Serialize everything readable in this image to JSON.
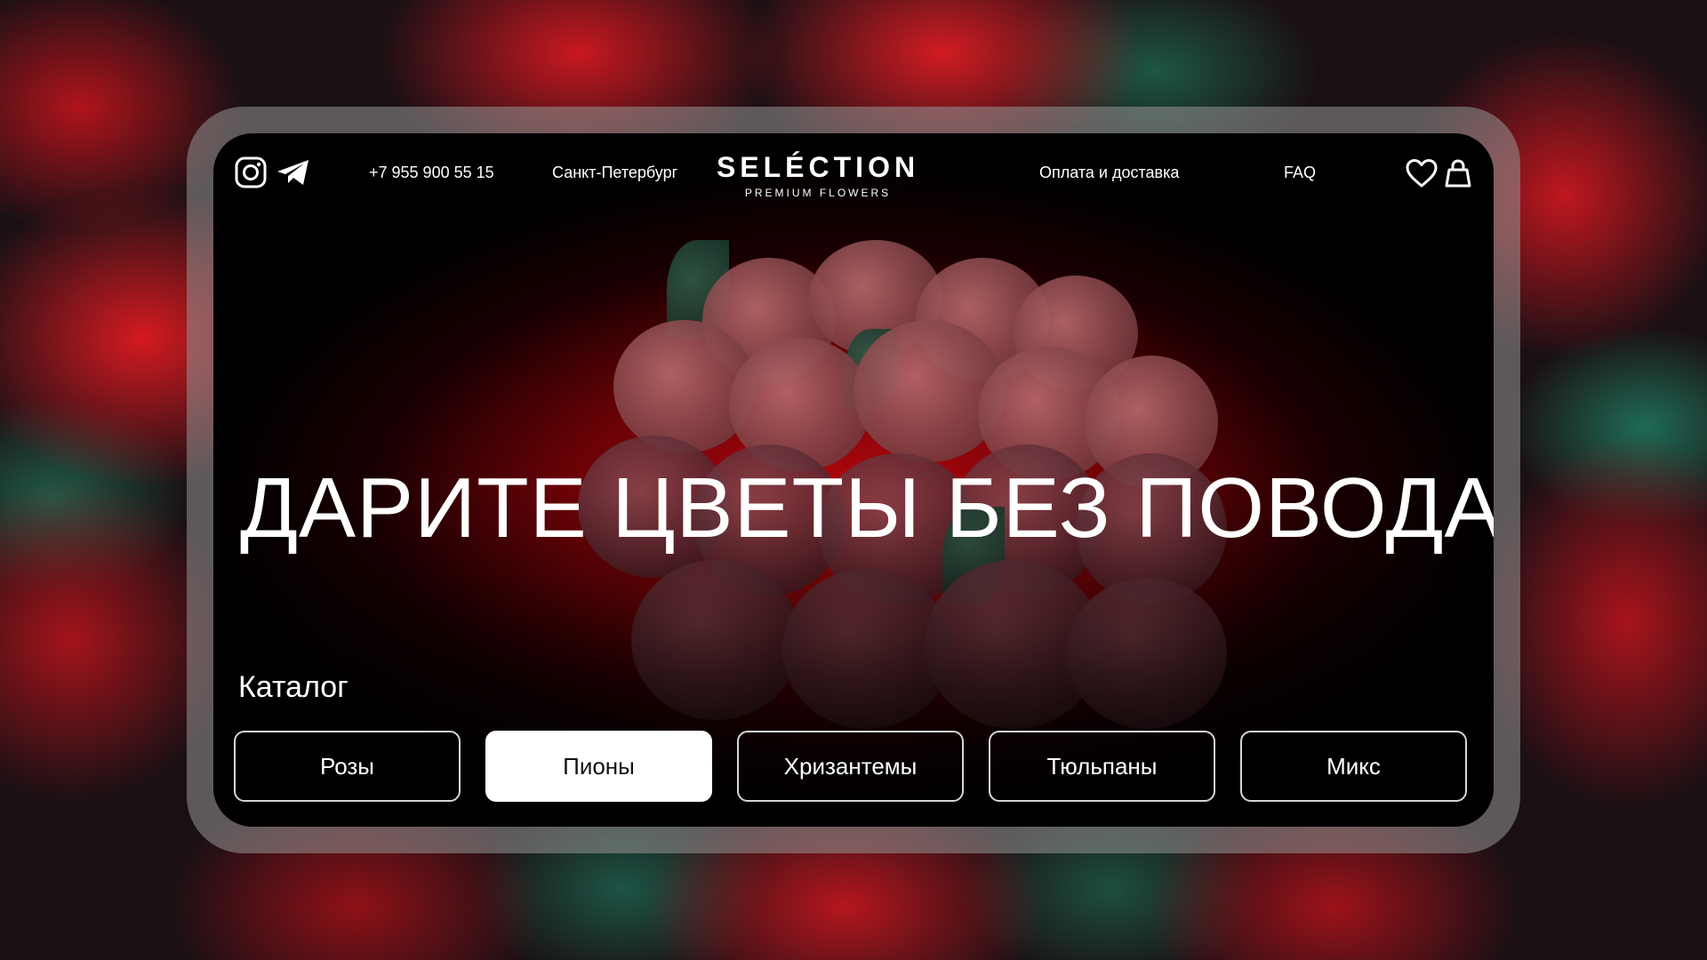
{
  "header": {
    "social": [
      {
        "icon": "instagram-icon"
      },
      {
        "icon": "telegram-icon"
      }
    ],
    "phone": "+7 955 900 55 15",
    "city": "Санкт-Петербург",
    "logo": {
      "main": "SELÉCTION",
      "sub": "PREMIUM FLOWERS"
    },
    "nav": {
      "delivery": "Оплата и доставка",
      "faq": "FAQ"
    },
    "actions": [
      {
        "icon": "heart-icon"
      },
      {
        "icon": "shopping-bag-icon"
      }
    ]
  },
  "hero": {
    "title": "ДАРИТЕ ЦВЕТЫ БЕЗ ПОВОДА"
  },
  "catalog": {
    "label": "Каталог",
    "categories": [
      {
        "label": "Розы",
        "active": false
      },
      {
        "label": "Пионы",
        "active": true
      },
      {
        "label": "Хризантемы",
        "active": false
      },
      {
        "label": "Тюльпаны",
        "active": false
      },
      {
        "label": "Микс",
        "active": false
      }
    ]
  },
  "colors": {
    "accent": "#c0070e",
    "background": "#000000",
    "text": "#ffffff",
    "active_button": "#ffffff"
  }
}
